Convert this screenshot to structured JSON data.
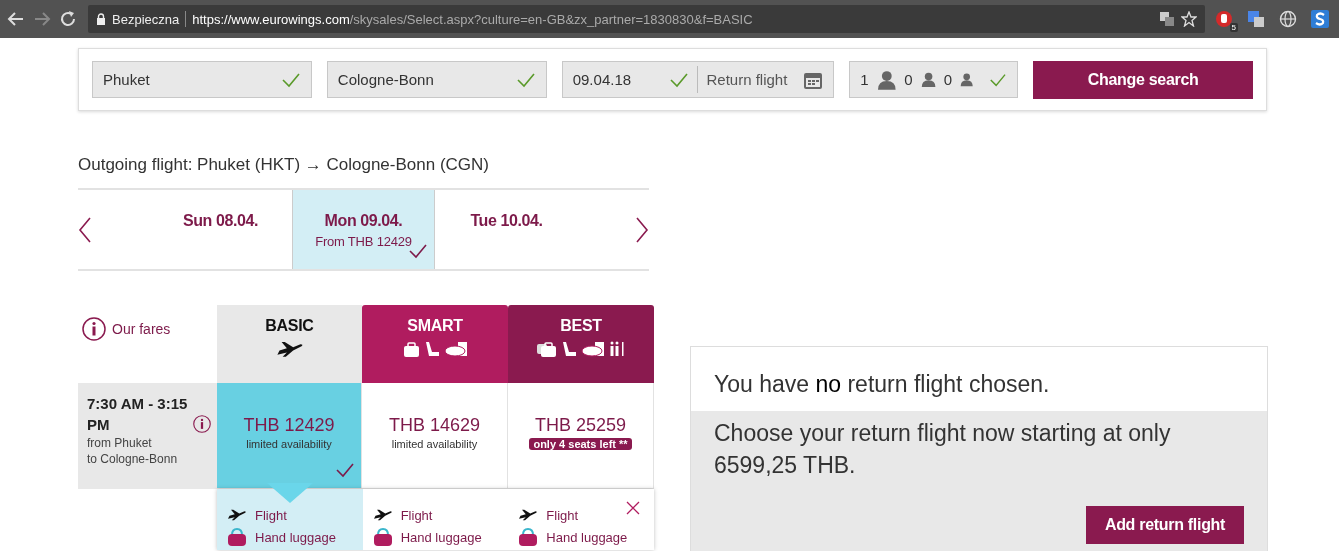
{
  "browser": {
    "secure_label": "Bezpieczna",
    "url_host": "https://www.eurowings.com",
    "url_path": "/skysales/Select.aspx?culture=en-GB&zx_partner=1830830&f=BASIC",
    "extension_badge": "5"
  },
  "search": {
    "origin": "Phuket",
    "destination": "Cologne-Bonn",
    "date": "09.04.18",
    "return_placeholder": "Return flight",
    "passengers": [
      {
        "count": "1",
        "kind": "adult"
      },
      {
        "count": "0",
        "kind": "child"
      },
      {
        "count": "0",
        "kind": "infant"
      }
    ],
    "button": "Change search"
  },
  "heading": "Outgoing flight: Phuket (HKT) → Cologne-Bonn (CGN)",
  "dates": [
    {
      "label": "Sun 08.04.",
      "selected": false
    },
    {
      "label": "Mon 09.04.",
      "price": "From THB 12429",
      "selected": true
    },
    {
      "label": "Tue 10.04.",
      "selected": false
    }
  ],
  "fares": {
    "info_label": "Our fares",
    "tiers": [
      {
        "name": "BASIC",
        "kind": "basic",
        "price": "THB 12429",
        "note": {
          "text": "limited availability",
          "kind": "text"
        },
        "selected": true
      },
      {
        "name": "SMART",
        "kind": "smart",
        "price": "THB 14629",
        "note": {
          "text": "limited availability",
          "kind": "text"
        },
        "selected": false
      },
      {
        "name": "BEST",
        "kind": "best",
        "price": "THB 25259",
        "note": {
          "text": "only 4 seats left **",
          "kind": "badge"
        },
        "selected": false
      }
    ]
  },
  "flight": {
    "time": "7:30 AM - 3:15 PM",
    "from": "from Phuket",
    "to": "to Cologne-Bonn"
  },
  "details": [
    [
      {
        "label": "Flight",
        "kind": "flight"
      },
      {
        "label": "Hand luggage",
        "kind": "bag"
      }
    ],
    [
      {
        "label": "Flight",
        "kind": "flight"
      },
      {
        "label": "Hand luggage",
        "kind": "bag"
      }
    ],
    [
      {
        "label": "Flight",
        "kind": "flight"
      },
      {
        "label": "Hand luggage",
        "kind": "bag"
      }
    ]
  ],
  "return_panel": {
    "title": "You have **no** return flight chosen.",
    "text": "Choose your return flight now starting at only 6599,25 THB.",
    "button": "Add return flight"
  }
}
